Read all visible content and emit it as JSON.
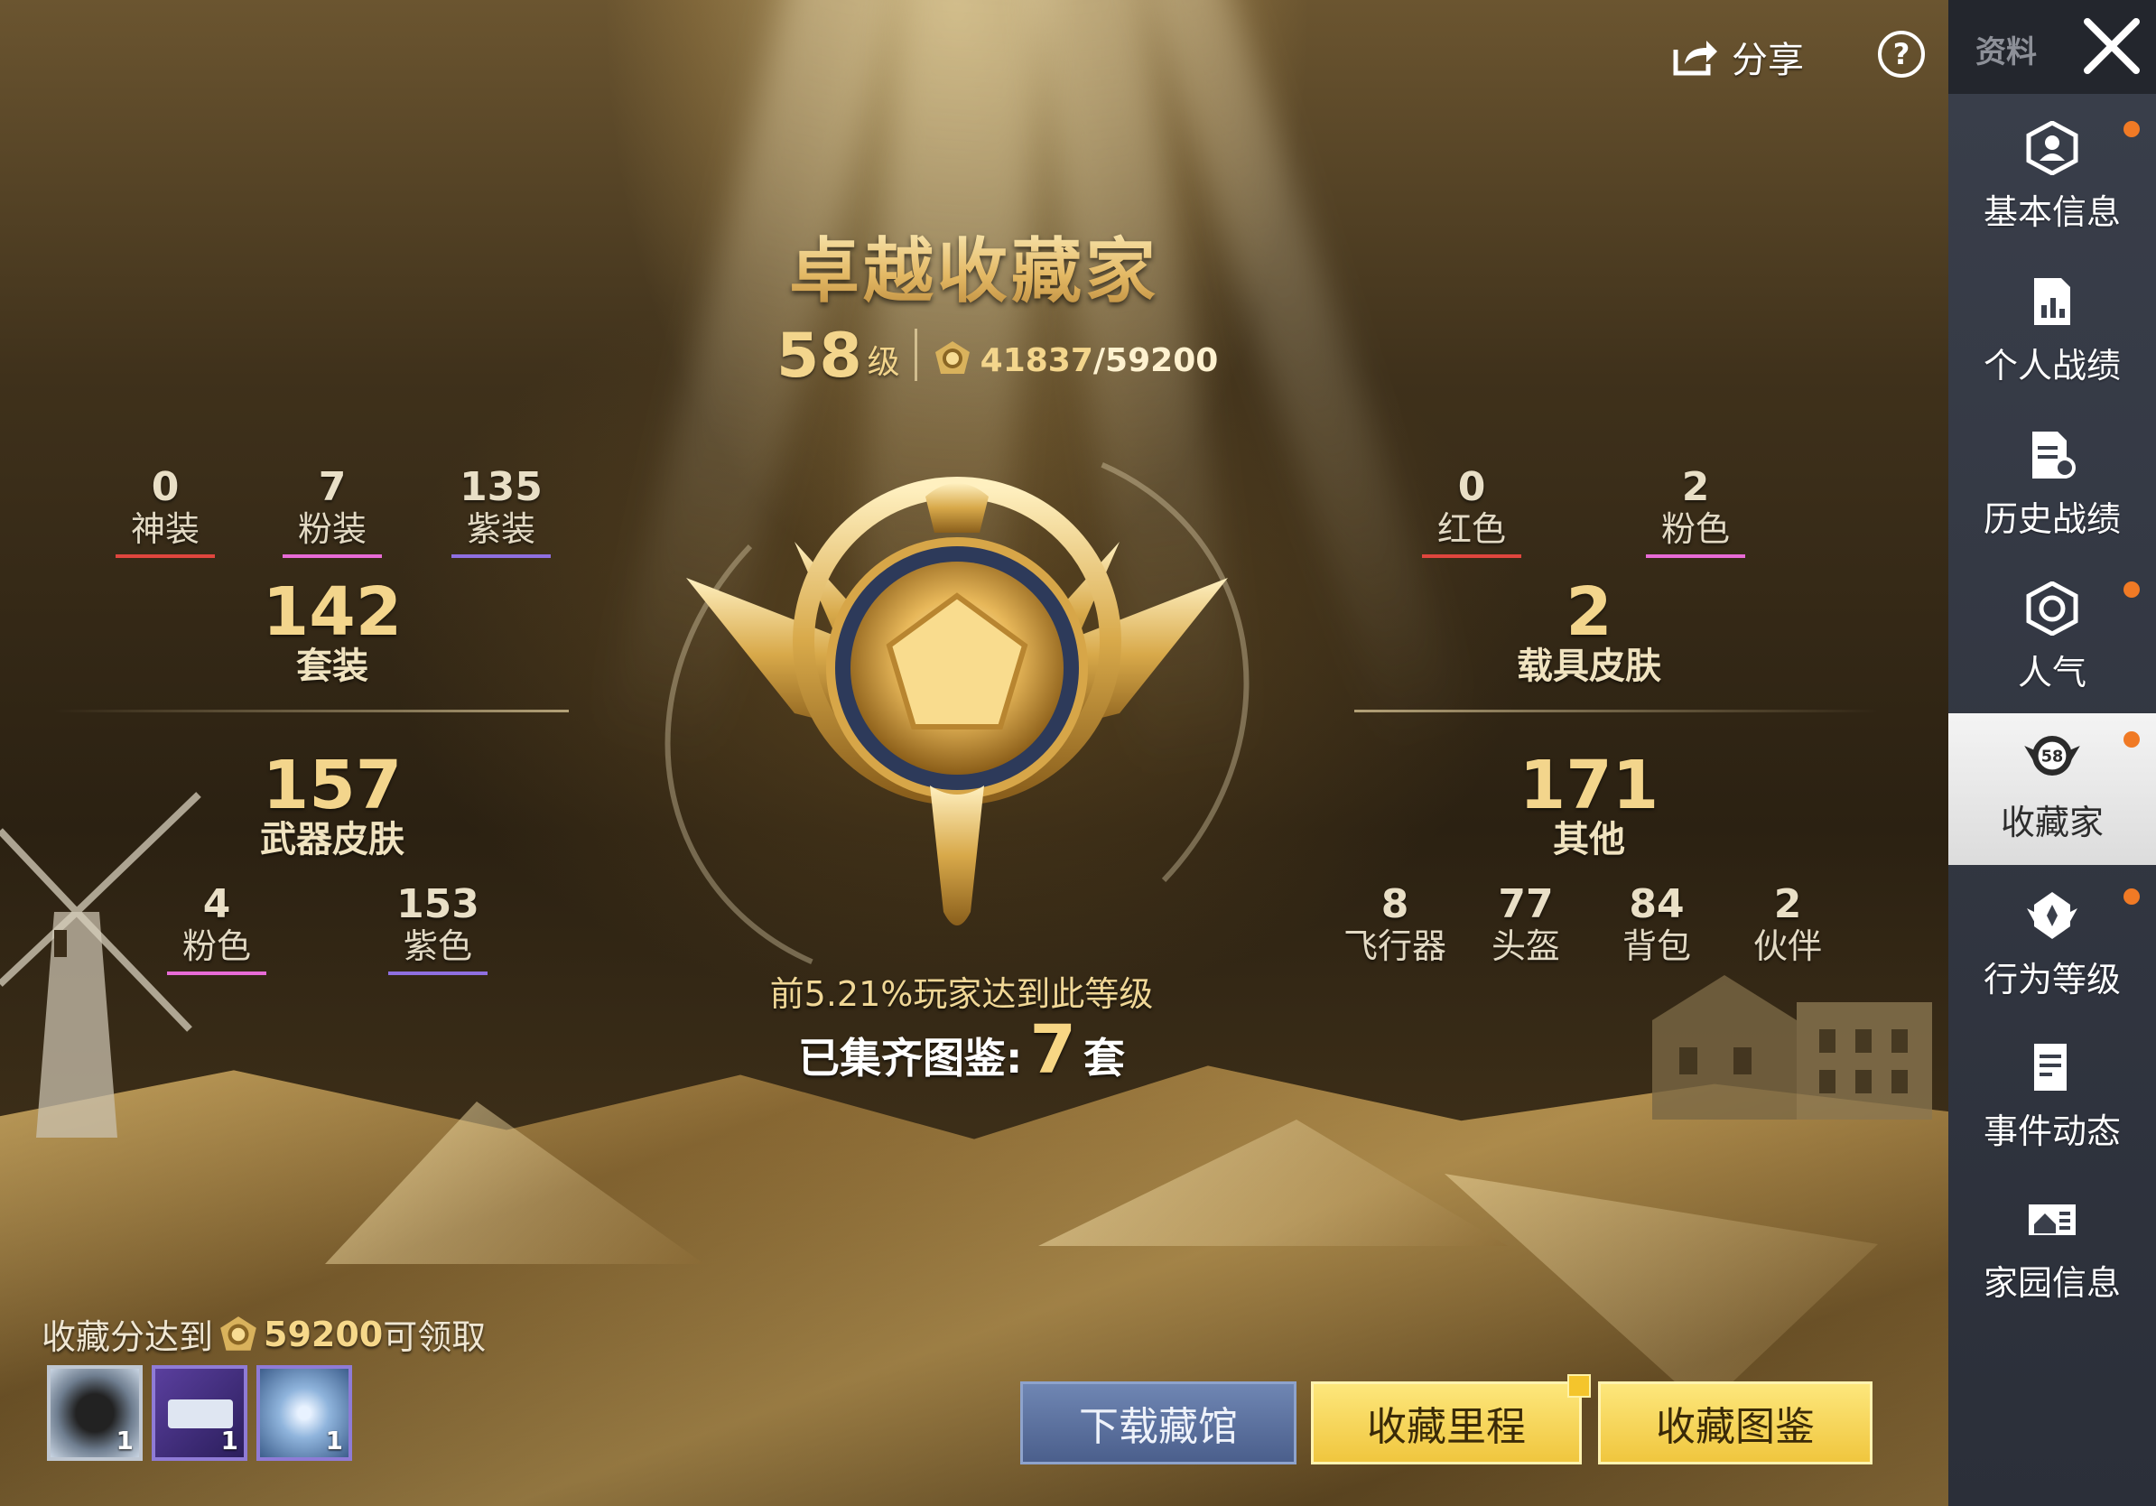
{
  "header": {
    "title": "卓越收藏家",
    "level_number": "58",
    "level_unit": "级",
    "points_current": "41837",
    "points_max": "/59200",
    "share_label": "分享",
    "help_label": "?"
  },
  "left_stats": {
    "top": [
      {
        "value": "0",
        "label": "神装",
        "color": "#e0463e"
      },
      {
        "value": "7",
        "label": "粉装",
        "color": "#e86bd6"
      },
      {
        "value": "135",
        "label": "紫装",
        "color": "#8f6fe0"
      }
    ],
    "suits": {
      "value": "142",
      "label": "套装"
    },
    "weapons": {
      "value": "157",
      "label": "武器皮肤"
    },
    "bottom": [
      {
        "value": "4",
        "label": "粉色",
        "color": "#e86bd6"
      },
      {
        "value": "153",
        "label": "紫色",
        "color": "#8f6fe0"
      }
    ]
  },
  "right_stats": {
    "top": [
      {
        "value": "0",
        "label": "红色",
        "color": "#e0463e"
      },
      {
        "value": "2",
        "label": "粉色",
        "color": "#e86bd6"
      }
    ],
    "vehicles": {
      "value": "2",
      "label": "载具皮肤"
    },
    "others": {
      "value": "171",
      "label": "其他"
    },
    "bottom": [
      {
        "value": "8",
        "label": "飞行器"
      },
      {
        "value": "77",
        "label": "头盔"
      },
      {
        "value": "84",
        "label": "背包"
      },
      {
        "value": "2",
        "label": "伙伴"
      }
    ]
  },
  "center": {
    "rank_text": "前5.21%玩家达到此等级",
    "set_prefix": "已集齐图鉴:",
    "set_count": "7",
    "set_unit": "套",
    "badge_icon": "collector-emblem-icon"
  },
  "reward": {
    "prefix": "收藏分达到",
    "value": "59200",
    "suffix": "可领取",
    "items": [
      {
        "icon": "avatar-frame-icon",
        "count": "1"
      },
      {
        "icon": "card-icon",
        "count": "1"
      },
      {
        "icon": "badge-icon",
        "count": "1"
      }
    ]
  },
  "buttons": {
    "download": "下载藏馆",
    "milestone": "收藏里程",
    "catalog": "收藏图鉴"
  },
  "sidebar": {
    "header_label": "资料",
    "items": [
      {
        "label": "基本信息",
        "icon": "person-hex-icon",
        "dot": true
      },
      {
        "label": "个人战绩",
        "icon": "chart-doc-icon",
        "dot": false
      },
      {
        "label": "历史战绩",
        "icon": "history-doc-icon",
        "dot": false
      },
      {
        "label": "人气",
        "icon": "popularity-icon",
        "dot": true
      },
      {
        "label": "收藏家",
        "icon": "collector-badge-icon",
        "dot": true,
        "badge": "58",
        "active": true
      },
      {
        "label": "行为等级",
        "icon": "behavior-icon",
        "dot": true
      },
      {
        "label": "事件动态",
        "icon": "event-doc-icon",
        "dot": false
      },
      {
        "label": "家园信息",
        "icon": "home-icon",
        "dot": false
      }
    ]
  },
  "colors": {
    "gold": "#f3d58c",
    "button_gold": "#f0c63e",
    "button_blue": "#5a6f9e",
    "notice_dot": "#f07a25"
  }
}
